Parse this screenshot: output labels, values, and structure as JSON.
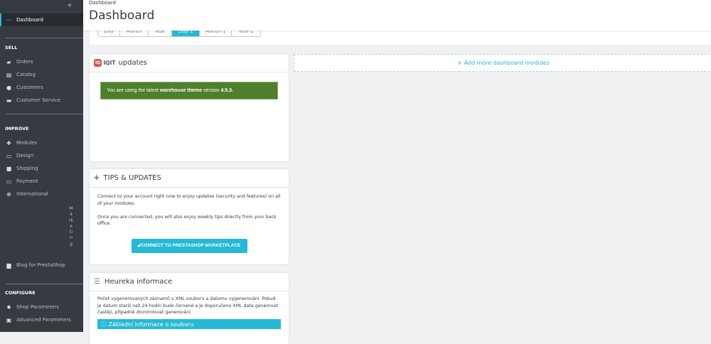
{
  "sidebar": {
    "collapse": "«",
    "active": "Dashboard",
    "sections": {
      "sell": "SELL",
      "improve": "IMPROVE",
      "configure": "CONFIGURE"
    },
    "sell": [
      "Orders",
      "Catalog",
      "Customers",
      "Customer Service"
    ],
    "improve": [
      "Modules",
      "Design",
      "Shipping",
      "Payment",
      "International"
    ],
    "marketing": "Marketing",
    "blog": "Blog for PrestaShop",
    "configure": [
      "Shop Parameters",
      "Advanced Parameters"
    ]
  },
  "header": {
    "breadcrumb": "Dashboard",
    "title": "Dashboard"
  },
  "dates": [
    "Day",
    "Month",
    "Year",
    "Day-1",
    "Month-1",
    "Year-1"
  ],
  "iqit": {
    "logo": "IQIT",
    "title": "updates",
    "msg_pre": "You are using the latest ",
    "msg_bold": "warehouse theme",
    "msg_mid": " version ",
    "version": "4.5.3."
  },
  "add_modules": "+ Add more dashboard modules",
  "tips": {
    "title": "TIPS & UPDATES",
    "p1": "Connect to your account right now to enjoy updates (security and features) on all of your modules.",
    "p2": "Once you are connected, you will also enjoy weekly tips directly from your back office.",
    "button": "CONNECT TO PRESTASHOP MARKETPLACE"
  },
  "heureka": {
    "title": "Heureka informace",
    "text": "Počet vygenerovaných záznamů v XML souboru a datumu vygenerování. Pokud je datum starší než 24 hodin bude červené a je doporučeno XML data generovat častěji, případně zkontrolovat generování.",
    "info": "Základní informace o souboru"
  }
}
